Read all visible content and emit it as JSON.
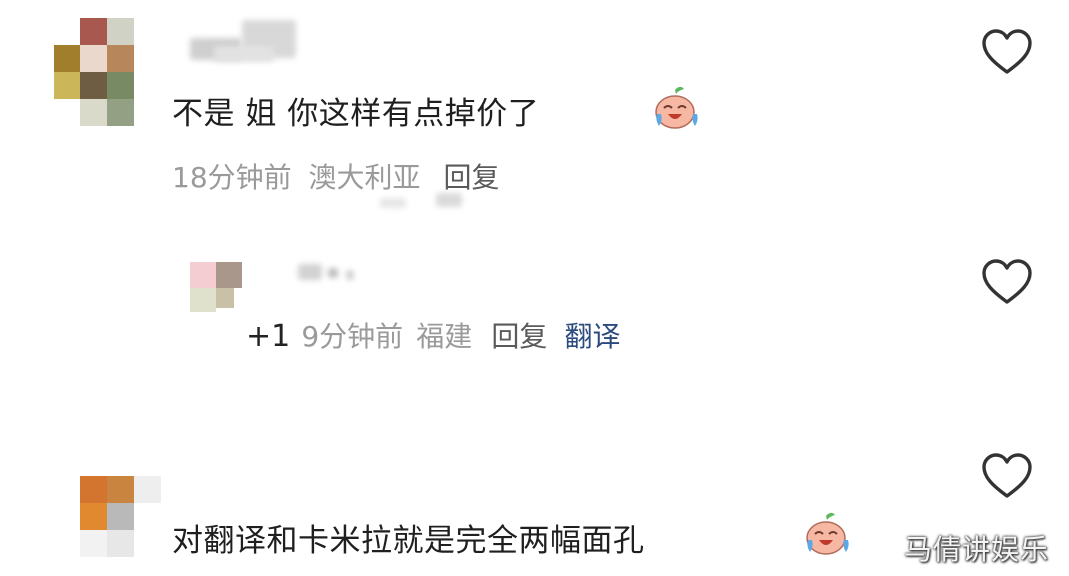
{
  "comments": [
    {
      "text": "不是 姐 你这样有点掉价了",
      "time": "18分钟前",
      "location": "澳大利亚",
      "reply_label": "回复"
    },
    {
      "plus_one": "+1",
      "time": "9分钟前",
      "location": "福建",
      "reply_label": "回复",
      "translate_label": "翻译"
    },
    {
      "text": "对翻译和卡米拉就是完全两幅面孔"
    }
  ],
  "watermark": "马倩讲娱乐",
  "icons": {
    "like": "heart-outline-icon",
    "emoji": "crying-laughing-emoji-icon"
  }
}
